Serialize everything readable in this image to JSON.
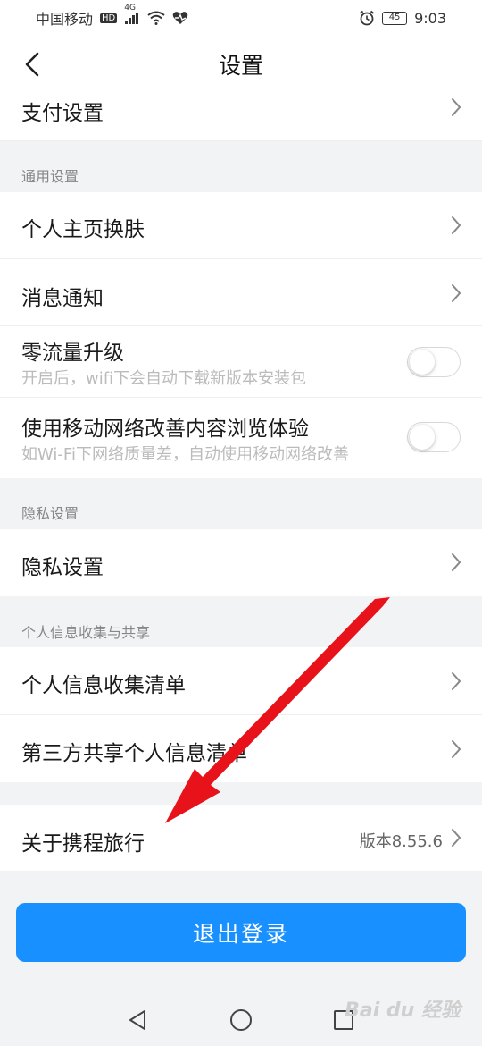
{
  "status_bar": {
    "carrier": "中国移动",
    "network_badge": "HD",
    "network_type": "4G",
    "battery": "45",
    "time": "9:03",
    "icons": [
      "hd-badge-icon",
      "signal-icon",
      "wifi-icon",
      "heart-pulse-icon",
      "alarm-icon",
      "battery-icon"
    ]
  },
  "header": {
    "title": "设置",
    "back_icon": "chevron-left-icon"
  },
  "rows": {
    "payment": {
      "label": "支付设置"
    },
    "skin": {
      "label": "个人主页换肤"
    },
    "notifications": {
      "label": "消息通知"
    },
    "zero_traffic": {
      "label": "零流量升级",
      "sub": "开启后，wifi下会自动下载新版本安装包",
      "enabled": false
    },
    "mobile_network": {
      "label": "使用移动网络改善内容浏览体验",
      "sub": "如Wi-Fi下网络质量差，自动使用移动网络改善",
      "enabled": false
    },
    "privacy": {
      "label": "隐私设置"
    },
    "info_list": {
      "label": "个人信息收集清单"
    },
    "third_party": {
      "label": "第三方共享个人信息清单"
    },
    "about": {
      "label": "关于携程旅行",
      "value": "版本8.55.6"
    }
  },
  "sections": {
    "general": "通用设置",
    "privacy": "隐私设置",
    "personal_info": "个人信息收集与共享"
  },
  "logout_label": "退出登录",
  "system_nav": [
    "back-triangle-icon",
    "home-circle-icon",
    "recents-square-icon"
  ],
  "watermark": "Bai du 经验",
  "colors": {
    "accent": "#1890ff",
    "annotation_arrow": "#e8131a"
  }
}
